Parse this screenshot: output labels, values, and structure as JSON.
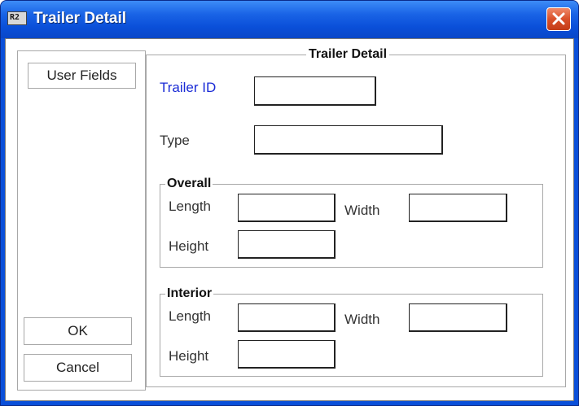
{
  "window": {
    "title": "Trailer Detail",
    "icon_text": "R2"
  },
  "left_panel": {
    "user_fields_label": "User Fields",
    "ok_label": "OK",
    "cancel_label": "Cancel"
  },
  "detail": {
    "legend": "Trailer Detail",
    "trailer_id_label": "Trailer ID",
    "trailer_id_value": "",
    "type_label": "Type",
    "type_value": ""
  },
  "overall": {
    "legend": "Overall",
    "length_label": "Length",
    "width_label": "Width",
    "height_label": "Height",
    "length_value": "",
    "width_value": "",
    "height_value": ""
  },
  "interior": {
    "legend": "Interior",
    "length_label": "Length",
    "width_label": "Width",
    "height_label": "Height",
    "length_value": "",
    "width_value": "",
    "height_value": ""
  },
  "colors": {
    "titlebar": "#0a4fd9",
    "accent_label": "#1a2bd6",
    "close_button": "#d9502a"
  },
  "icons": {
    "app": "app-icon",
    "close": "close-icon"
  }
}
